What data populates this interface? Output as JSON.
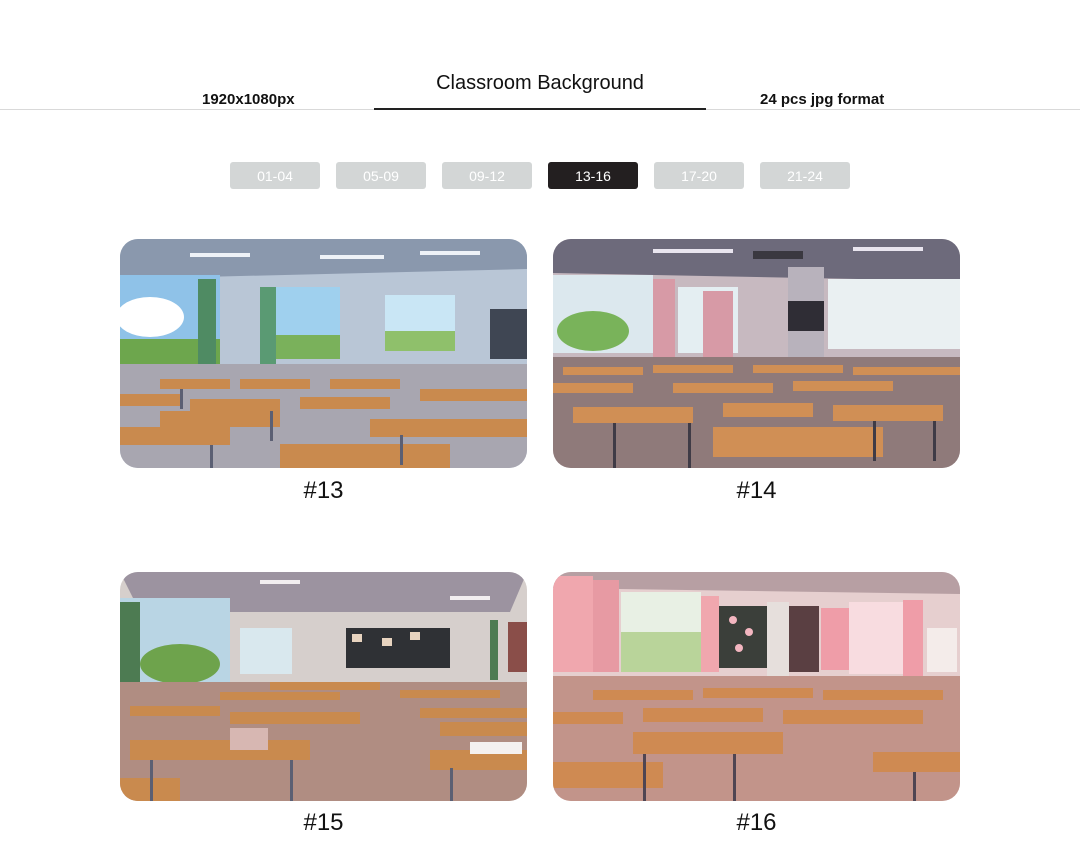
{
  "header": {
    "title": "Classroom Background",
    "resolution": "1920x1080px",
    "format": "24 pcs jpg format"
  },
  "tabs": [
    {
      "label": "01-04",
      "active": false
    },
    {
      "label": "05-09",
      "active": false
    },
    {
      "label": "09-12",
      "active": false
    },
    {
      "label": "13-16",
      "active": true
    },
    {
      "label": "17-20",
      "active": false
    },
    {
      "label": "21-24",
      "active": false
    }
  ],
  "gallery": [
    {
      "caption": "#13"
    },
    {
      "caption": "#14"
    },
    {
      "caption": "#15"
    },
    {
      "caption": "#16"
    }
  ],
  "colors": {
    "tab_inactive": "#d3d6d6",
    "tab_active": "#231f20",
    "desk": "#c98a4e"
  }
}
